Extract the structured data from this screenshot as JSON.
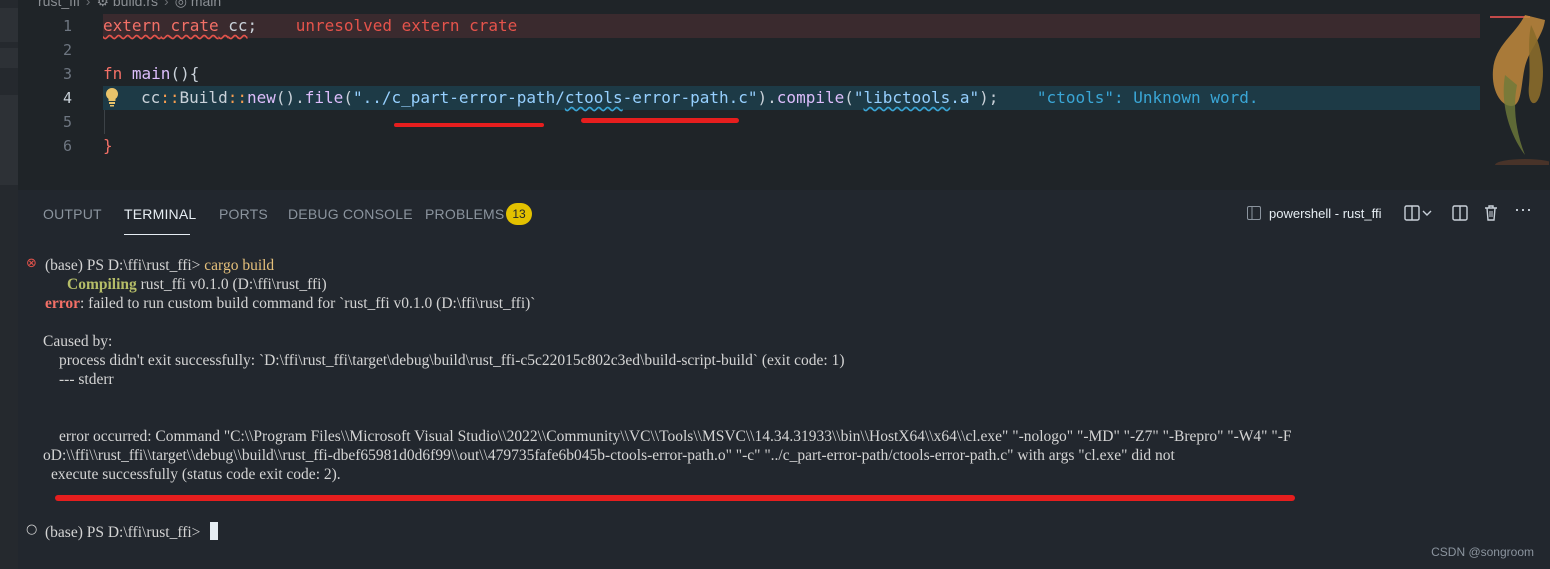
{
  "breadcrumb": {
    "folder": "rust_ffi",
    "file": "build.rs",
    "symbol": "main"
  },
  "editor": {
    "lines": [
      {
        "num": "1",
        "kw1": "extern",
        "kw2": "crate",
        "name": "cc",
        "semi": ";",
        "diagnostic": "unresolved extern crate"
      },
      {
        "num": "2"
      },
      {
        "num": "3",
        "kw": "fn",
        "name": "main",
        "paren": "(){"
      },
      {
        "num": "4",
        "p1": "cc",
        "sep1": "::",
        "p2": "Build",
        "sep2": "::",
        "p3": "new",
        "p4": "().",
        "p5": "file",
        "p6": "(",
        "s1": "\"../c_part-error-path/",
        "s2": "ctools",
        "s3": "-error-path.c\"",
        "p7": ").",
        "p8": "compile",
        "p9": "(",
        "s4": "\"",
        "s5": "libctools",
        "s6": ".a\"",
        "p10": ");",
        "diagnostic": "\"ctools\": Unknown word."
      },
      {
        "num": "5"
      },
      {
        "num": "6",
        "brace": "}"
      }
    ]
  },
  "panel": {
    "tabs": [
      "OUTPUT",
      "TERMINAL",
      "PORTS",
      "DEBUG CONSOLE",
      "PROBLEMS"
    ],
    "active_tab": "TERMINAL",
    "problems_count": "13",
    "terminal_name": "powershell - rust_ffi"
  },
  "terminal": {
    "prompt1": "(base) PS D:\\ffi\\rust_ffi> ",
    "command1": "cargo build",
    "compiling_label": "Compiling",
    "compiling_rest": " rust_ffi v0.1.0 (D:\\ffi\\rust_ffi)",
    "error_label": "error",
    "error_rest": ": failed to run custom build command for `rust_ffi v0.1.0 (D:\\ffi\\rust_ffi)`",
    "caused_by": "Caused by:",
    "process_line": "process didn't exit successfully: `D:\\ffi\\rust_ffi\\target\\debug\\build\\rust_ffi-c5c22015c802c3ed\\build-script-build` (exit code: 1)",
    "stderr_line": "--- stderr",
    "err_line1": "error occurred: Command \"C:\\\\Program Files\\\\Microsoft Visual Studio\\\\2022\\\\Community\\\\VC\\\\Tools\\\\MSVC\\\\14.34.31933\\\\bin\\\\HostX64\\\\x64\\\\cl.exe\" \"-nologo\" \"-MD\" \"-Z7\" \"-Brepro\" \"-W4\" \"-F",
    "err_line2": "oD:\\\\ffi\\\\rust_ffi\\\\target\\\\debug\\\\build\\\\rust_ffi-dbef65981d0d6f99\\\\out\\\\479735fafe6b045b-ctools-error-path.o\" \"-c\" \"../c_part-error-path/ctools-error-path.c\" with args \"cl.exe\" did not",
    "err_line3": "execute successfully (status code exit code: 2).",
    "prompt2": "(base) PS D:\\ffi\\rust_ffi> "
  },
  "watermark": "CSDN @songroom"
}
